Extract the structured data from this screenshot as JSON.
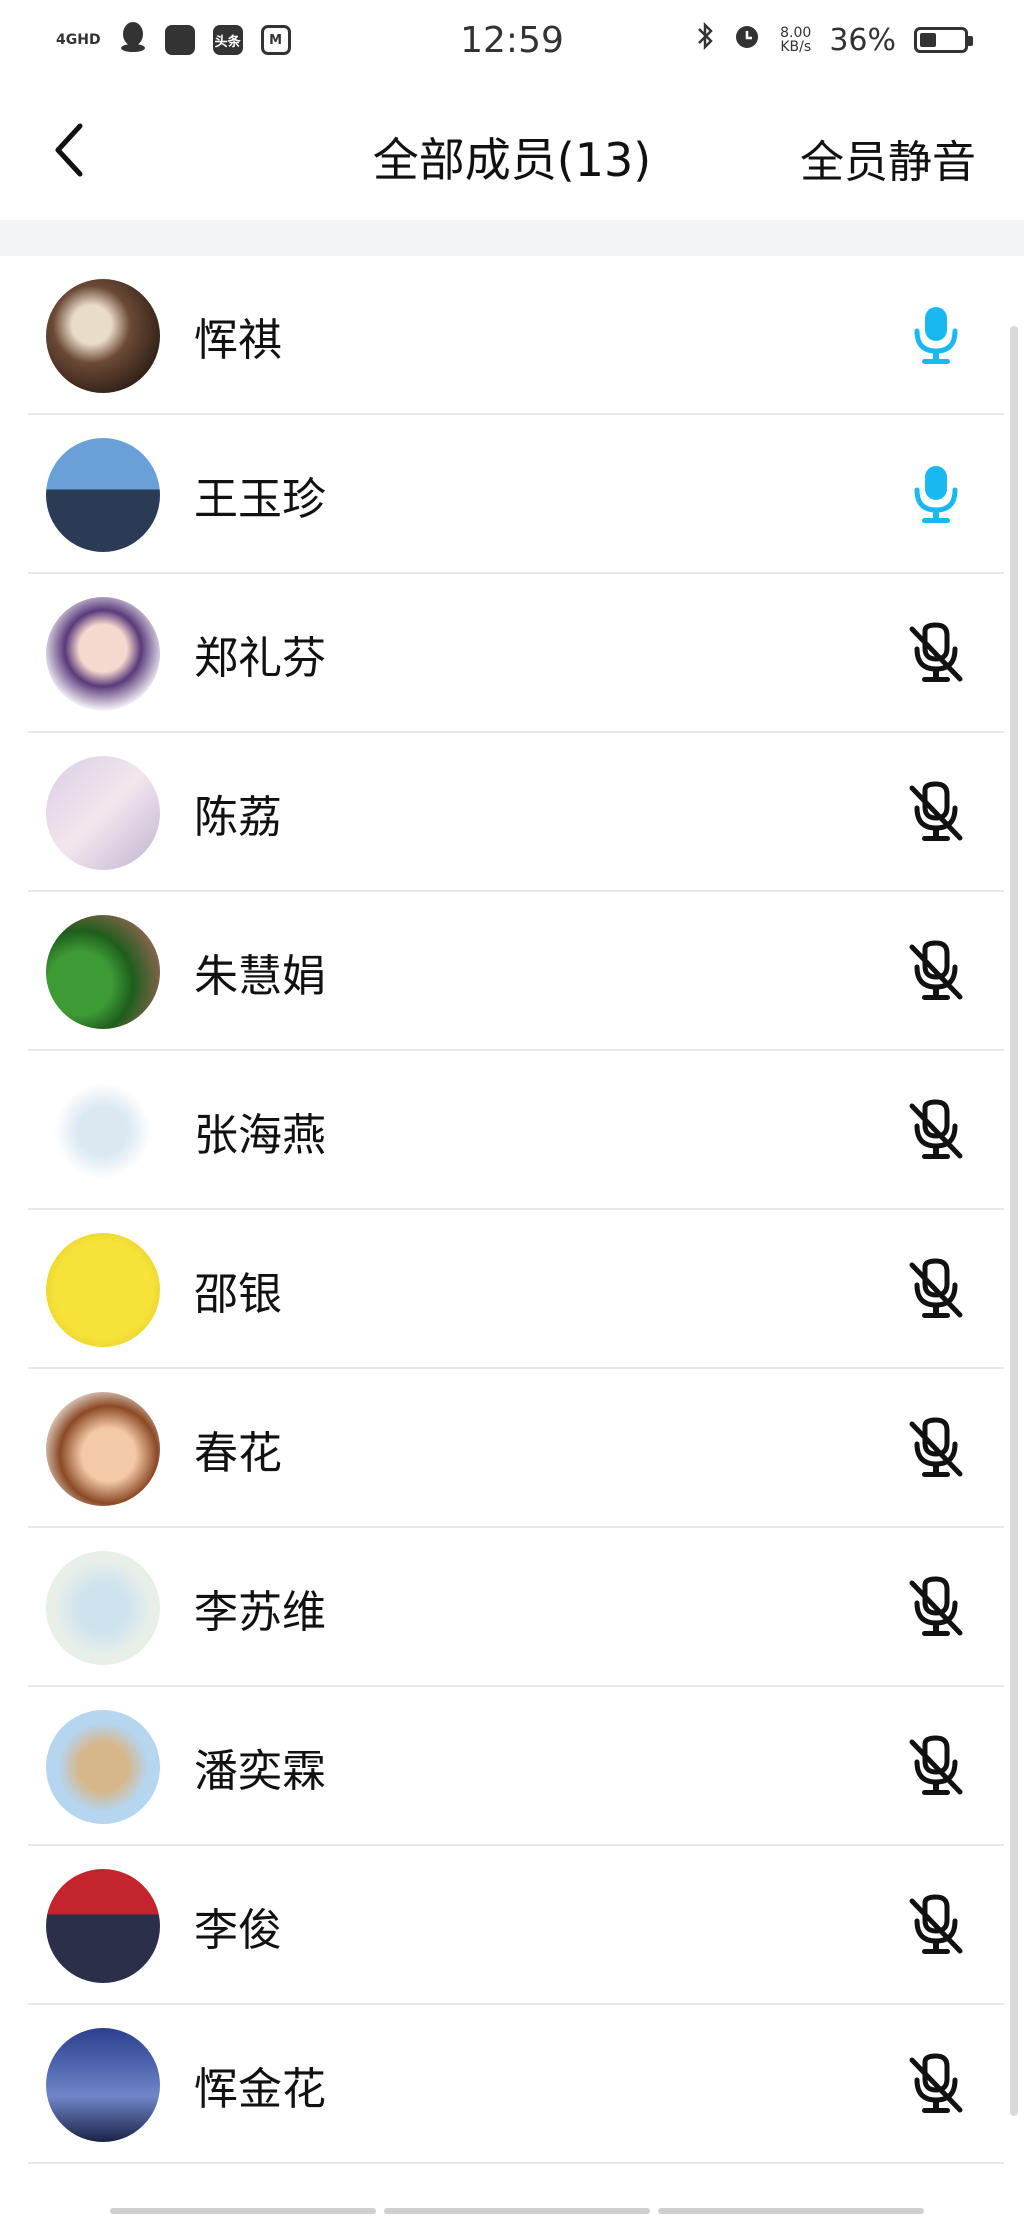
{
  "status_bar": {
    "network": "4GHD",
    "time": "12:59",
    "speed_value": "8.00",
    "speed_unit": "KB/s",
    "battery_percent": "36%",
    "battery_level": 0.36,
    "apps": [
      "qq-icon",
      "app-icon",
      "toutiao-icon",
      "mv-icon"
    ],
    "toutiao_label": "头条"
  },
  "header": {
    "title": "全部成员(13)",
    "mute_all": "全员静音"
  },
  "colors": {
    "mic_on": "#1ab8f0",
    "mic_off": "#111111"
  },
  "members": [
    {
      "name": "恽祺",
      "mic": "on"
    },
    {
      "name": "王玉珍",
      "mic": "on"
    },
    {
      "name": "郑礼芬",
      "mic": "off"
    },
    {
      "name": "陈荔",
      "mic": "off"
    },
    {
      "name": "朱慧娟",
      "mic": "off"
    },
    {
      "name": "张海燕",
      "mic": "off"
    },
    {
      "name": "邵银",
      "mic": "off"
    },
    {
      "name": "春花",
      "mic": "off"
    },
    {
      "name": "李苏维",
      "mic": "off"
    },
    {
      "name": "潘奕霖",
      "mic": "off"
    },
    {
      "name": "李俊",
      "mic": "off"
    },
    {
      "name": "恽金花",
      "mic": "off"
    }
  ]
}
